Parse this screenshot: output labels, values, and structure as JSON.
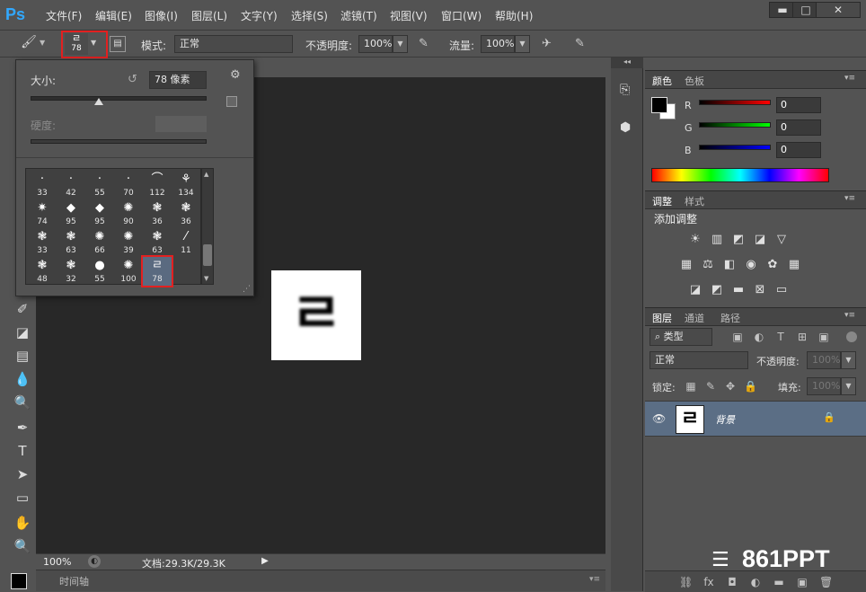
{
  "app": {
    "logo": "Ps"
  },
  "menu": [
    "文件(F)",
    "编辑(E)",
    "图像(I)",
    "图层(L)",
    "文字(Y)",
    "选择(S)",
    "滤镜(T)",
    "视图(V)",
    "窗口(W)",
    "帮助(H)"
  ],
  "window_controls": {
    "minimize": "▬",
    "maximize": "□",
    "close": "✕"
  },
  "options": {
    "brush_size": "78",
    "brush_glyph": "ㄹ",
    "mode_label": "模式:",
    "mode_value": "正常",
    "opacity_label": "不透明度:",
    "opacity_value": "100%",
    "flow_label": "流量:",
    "flow_value": "100%"
  },
  "brush_popup": {
    "size_label": "大小:",
    "size_value": "78 像素",
    "hardness_label": "硬度:",
    "presets": [
      {
        "glyph": "·",
        "num": "33"
      },
      {
        "glyph": "·",
        "num": "42"
      },
      {
        "glyph": "·",
        "num": "55"
      },
      {
        "glyph": "·",
        "num": "70"
      },
      {
        "glyph": "⌒",
        "num": "112"
      },
      {
        "glyph": "⚘",
        "num": "134"
      },
      {
        "glyph": "✷",
        "num": "74"
      },
      {
        "glyph": "◆",
        "num": "95"
      },
      {
        "glyph": "◆",
        "num": "95"
      },
      {
        "glyph": "✺",
        "num": "90"
      },
      {
        "glyph": "❃",
        "num": "36"
      },
      {
        "glyph": "❃",
        "num": "36"
      },
      {
        "glyph": "❃",
        "num": "33"
      },
      {
        "glyph": "❃",
        "num": "63"
      },
      {
        "glyph": "✺",
        "num": "66"
      },
      {
        "glyph": "✺",
        "num": "39"
      },
      {
        "glyph": "❃",
        "num": "63"
      },
      {
        "glyph": "⁄",
        "num": "11"
      },
      {
        "glyph": "❃",
        "num": "48"
      },
      {
        "glyph": "❃",
        "num": "32"
      },
      {
        "glyph": "●",
        "num": "55"
      },
      {
        "glyph": "✺",
        "num": "100"
      },
      {
        "glyph": "ㄹ",
        "num": "78"
      }
    ]
  },
  "canvas": {
    "glyph": "ㄹ"
  },
  "status": {
    "zoom": "100%",
    "doc": "文档:29.3K/29.3K"
  },
  "timeline": {
    "label": "时间轴"
  },
  "color_panel": {
    "tabs": [
      "颜色",
      "色板"
    ],
    "channels": [
      {
        "label": "R",
        "value": "0"
      },
      {
        "label": "G",
        "value": "0"
      },
      {
        "label": "B",
        "value": "0"
      }
    ]
  },
  "adjust_panel": {
    "tabs": [
      "调整",
      "样式"
    ],
    "title": "添加调整"
  },
  "layers_panel": {
    "tabs": [
      "图层",
      "通道",
      "路径"
    ],
    "filter_label": "类型",
    "blend": "正常",
    "opacity_label": "不透明度:",
    "opacity_value": "100%",
    "lock_label": "锁定:",
    "fill_label": "填充:",
    "fill_value": "100%",
    "layer_name": "背景",
    "layer_thumb": "ㄹ"
  },
  "watermark": {
    "text": "861PPT"
  },
  "colors": {
    "accent_blue": "#31a8ff",
    "highlight_red": "#e32020",
    "selected_layer": "#5b6e85"
  }
}
